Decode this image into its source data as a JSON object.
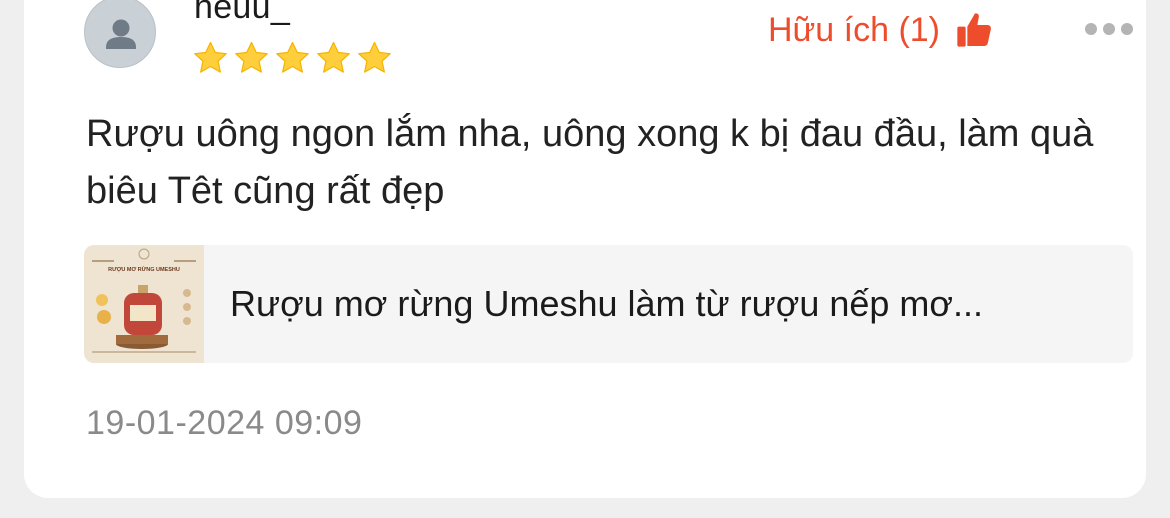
{
  "review": {
    "username": "heuu_",
    "rating": 5,
    "rating_max": 5,
    "helpful_label": "Hữu ích (1)",
    "comment": "Rượu uông ngon lắm nha, uông xong k bị đau đầu, làm quà biêu Têt cũng rất đẹp",
    "timestamp": "19-01-2024 09:09"
  },
  "product": {
    "name": "Rượu mơ rừng Umeshu làm từ rượu nếp mơ...",
    "thumbnail_title": "RƯỢU MƠ RỪNG UMESHU"
  },
  "icons": {
    "avatar": "user-avatar-icon",
    "star": "star-icon",
    "thumb": "thumbs-up-icon",
    "more": "more-options-icon"
  },
  "colors": {
    "accent": "#ee4d2d",
    "star": "#ffce3d",
    "background": "#efefef",
    "card": "#ffffff",
    "muted_text": "#8a8a8a"
  }
}
